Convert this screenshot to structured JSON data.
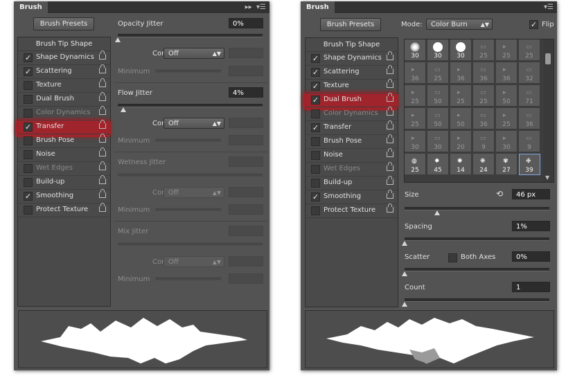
{
  "left_panel": {
    "tab": "Brush",
    "presets_button": "Brush Presets",
    "tip_shape_header": "Brush Tip Shape",
    "options": [
      {
        "label": "Shape Dynamics",
        "checked": "✓"
      },
      {
        "label": "Scattering",
        "checked": "✓"
      },
      {
        "label": "Texture",
        "checked": ""
      },
      {
        "label": "Dual Brush",
        "checked": ""
      },
      {
        "label": "Color Dynamics",
        "checked": ""
      },
      {
        "label": "Transfer",
        "checked": "✓"
      },
      {
        "label": "Brush Pose",
        "checked": ""
      },
      {
        "label": "Noise",
        "checked": ""
      },
      {
        "label": "Wet Edges",
        "checked": ""
      },
      {
        "label": "Build-up",
        "checked": ""
      },
      {
        "label": "Smoothing",
        "checked": "✓"
      },
      {
        "label": "Protect Texture",
        "checked": ""
      }
    ],
    "opacity_jitter": {
      "label": "Opacity Jitter",
      "value": "0%",
      "control_label": "Control:",
      "control_value": "Off",
      "minimum_label": "Minimum"
    },
    "flow_jitter": {
      "label": "Flow Jitter",
      "value": "4%",
      "control_label": "Control:",
      "control_value": "Off",
      "minimum_label": "Minimum"
    },
    "wetness_jitter": {
      "label": "Wetness Jitter",
      "control_label": "Control:",
      "control_value": "Off",
      "minimum_label": "Minimum"
    },
    "mix_jitter": {
      "label": "Mix Jitter",
      "control_label": "Control:",
      "control_value": "Off",
      "minimum_label": "Minimum"
    }
  },
  "right_panel": {
    "tab": "Brush",
    "presets_button": "Brush Presets",
    "tip_shape_header": "Brush Tip Shape",
    "mode_label": "Mode:",
    "mode_value": "Color Burn",
    "flip_label": "Flip",
    "flip_checked": "✓",
    "options": [
      {
        "label": "Shape Dynamics",
        "checked": "✓"
      },
      {
        "label": "Scattering",
        "checked": "✓"
      },
      {
        "label": "Texture",
        "checked": "✓"
      },
      {
        "label": "Dual Brush",
        "checked": "✓"
      },
      {
        "label": "Color Dynamics",
        "checked": ""
      },
      {
        "label": "Transfer",
        "checked": "✓"
      },
      {
        "label": "Brush Pose",
        "checked": ""
      },
      {
        "label": "Noise",
        "checked": ""
      },
      {
        "label": "Wet Edges",
        "checked": ""
      },
      {
        "label": "Build-up",
        "checked": ""
      },
      {
        "label": "Smoothing",
        "checked": "✓"
      },
      {
        "label": "Protect Texture",
        "checked": ""
      }
    ],
    "brush_grid": [
      [
        "30",
        "30",
        "30",
        "25",
        "25",
        "25"
      ],
      [
        "36",
        "25",
        "36",
        "36",
        "36",
        "32"
      ],
      [
        "25",
        "50",
        "25",
        "25",
        "50",
        "71"
      ],
      [
        "25",
        "50",
        "50",
        "36",
        "25",
        "36"
      ],
      [
        "30",
        "30",
        "20",
        "9",
        "30",
        "9"
      ],
      [
        "25",
        "45",
        "14",
        "24",
        "27",
        "39"
      ]
    ],
    "size_label": "Size",
    "size_value": "46 px",
    "spacing_label": "Spacing",
    "spacing_value": "1%",
    "scatter_label": "Scatter",
    "both_axes_label": "Both Axes",
    "scatter_value": "0%",
    "count_label": "Count",
    "count_value": "1"
  },
  "colors": {
    "panel": "#535353",
    "highlight": "#b91923",
    "tabbar": "#323232"
  }
}
